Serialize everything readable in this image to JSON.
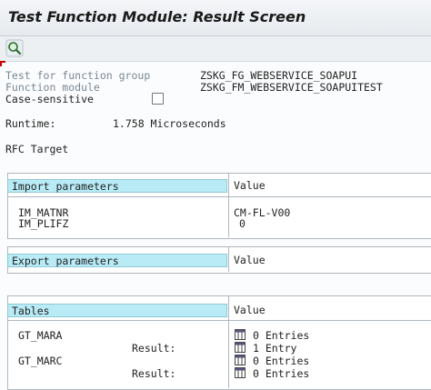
{
  "window": {
    "title": "Test Function Module: Result Screen"
  },
  "toolbar": {
    "icon": "magnifier-icon"
  },
  "info": {
    "group_label": "Test for function group",
    "group_value": "ZSKG_FG_WEBSERVICE_SOAPUI",
    "module_label": "Function module",
    "module_value": "ZSKG_FM_WEBSERVICE_SOAPUITEST",
    "case_label": "Case-sensitive",
    "runtime_label": "Runtime:",
    "runtime_value": "1.758 Microseconds",
    "rfc_label": "RFC Target"
  },
  "import": {
    "header": "Import parameters",
    "value_header": "Value",
    "rows": [
      {
        "name": "IM_MATNR",
        "value": "CM-FL-V00"
      },
      {
        "name": "IM_PLIFZ",
        "value": "0"
      }
    ]
  },
  "export": {
    "header": "Export parameters",
    "value_header": "Value"
  },
  "tables": {
    "header": "Tables",
    "value_header": "Value",
    "result_label": "Result:",
    "rows": [
      {
        "name": "GT_MARA",
        "value": "0 Entries",
        "result": "1 Entry"
      },
      {
        "name": "GT_MARC",
        "value": "0 Entries",
        "result": "0 Entries"
      }
    ]
  },
  "colors": {
    "header_bg": "#b8ebf6",
    "label_gray": "#7b8792"
  }
}
